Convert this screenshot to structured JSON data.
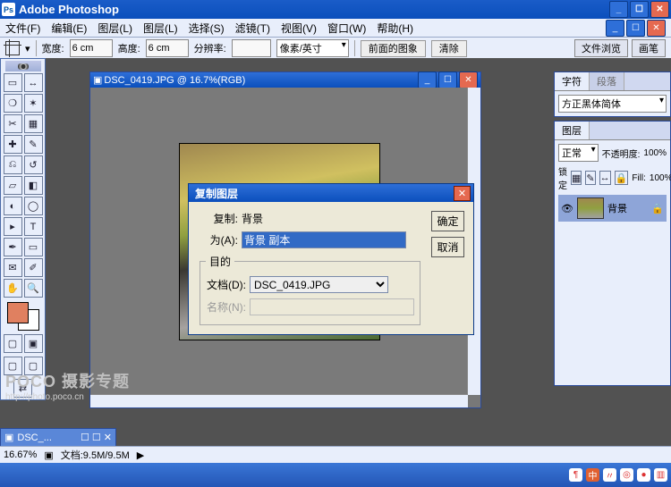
{
  "app": {
    "title": "Adobe Photoshop"
  },
  "menu": {
    "items": [
      "文件(F)",
      "编辑(E)",
      "图层(L)",
      "图层(L)",
      "选择(S)",
      "滤镜(T)",
      "视图(V)",
      "窗口(W)",
      "帮助(H)"
    ]
  },
  "optionsbar": {
    "width_label": "宽度:",
    "width_value": "6 cm",
    "height_label": "高度:",
    "height_value": "6 cm",
    "res_label": "分辨率:",
    "res_value": "",
    "res_unit": "像素/英寸",
    "front_btn": "前面的图象",
    "clear_btn": "清除",
    "preset_tab": "文件浏览",
    "brush_tab": "画笔"
  },
  "doc": {
    "title": "DSC_0419.JPG @ 16.7%(RGB)"
  },
  "dialog": {
    "title": "复制图层",
    "copy_label": "复制:",
    "copy_value": "背景",
    "as_label": "为(A):",
    "as_value": "背景 副本",
    "dest_legend": "目的",
    "doc_label": "文档(D):",
    "doc_value": "DSC_0419.JPG",
    "name_label": "名称(N):",
    "ok": "确定",
    "cancel": "取消"
  },
  "panels": {
    "char_tab": "字符",
    "para_tab": "段落",
    "font": "方正黑体简体",
    "layers_tab": "图层",
    "mode": "正常",
    "opacity_label": "不透明度:",
    "opacity_value": "100%",
    "lock_label": "锁定",
    "fill_label": "Fill:",
    "fill_value": "100%",
    "layer0": "背景"
  },
  "status": {
    "zoom": "16.67%",
    "docinfo": "文档:9.5M/9.5M"
  },
  "doctab": {
    "label": "DSC_..."
  },
  "watermark": {
    "brand": "POCO 摄影专题",
    "url": "http://photo.poco.cn"
  },
  "tray": {
    "items": [
      "¶",
      "中",
      "〃",
      "◎",
      "●",
      "▥"
    ]
  }
}
